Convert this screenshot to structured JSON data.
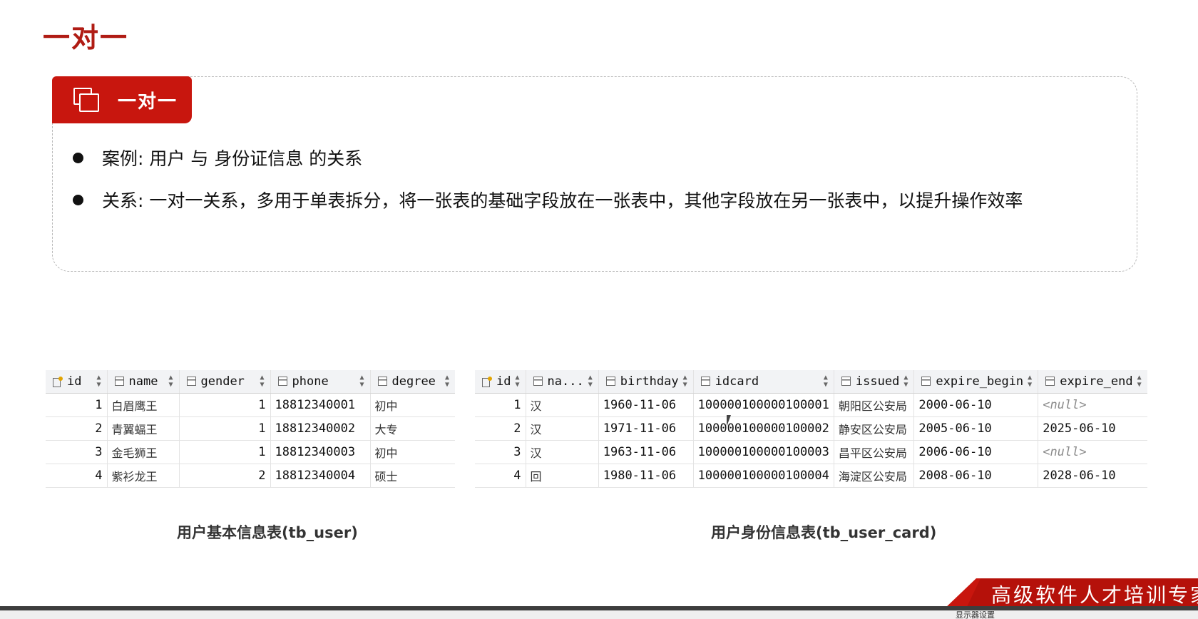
{
  "page": {
    "title": "一对一"
  },
  "card": {
    "tab_label": "一对一",
    "tab_icon": "copy-icon",
    "bullets": [
      "案例: 用户 与 身份证信息 的关系",
      "关系: 一对一关系，多用于单表拆分，将一张表的基础字段放在一张表中，其他字段放在另一张表中，以提升操作效率"
    ]
  },
  "tb_user": {
    "caption": "用户基本信息表(tb_user)",
    "columns": [
      "id",
      "name",
      "gender",
      "phone",
      "degree"
    ],
    "rows": [
      [
        "1",
        "白眉鹰王",
        "1",
        "18812340001",
        "初中"
      ],
      [
        "2",
        "青翼蝠王",
        "1",
        "18812340002",
        "大专"
      ],
      [
        "3",
        "金毛狮王",
        "1",
        "18812340003",
        "初中"
      ],
      [
        "4",
        "紫衫龙王",
        "2",
        "18812340004",
        "硕士"
      ]
    ]
  },
  "tb_user_card": {
    "caption": "用户身份信息表(tb_user_card)",
    "columns": [
      "id",
      "na...",
      "birthday",
      "idcard",
      "issued",
      "expire_begin",
      "expire_end"
    ],
    "rows": [
      [
        "1",
        "汉",
        "1960-11-06",
        "100000100000100001",
        "朝阳区公安局",
        "2000-06-10",
        "<null>"
      ],
      [
        "2",
        "汉",
        "1971-11-06",
        "100000100000100002",
        "静安区公安局",
        "2005-06-10",
        "2025-06-10"
      ],
      [
        "3",
        "汉",
        "1963-11-06",
        "100000100000100003",
        "昌平区公安局",
        "2006-06-10",
        "<null>"
      ],
      [
        "4",
        "回",
        "1980-11-06",
        "100000100000100004",
        "海淀区公安局",
        "2008-06-10",
        "2028-06-10"
      ]
    ]
  },
  "brand": {
    "text": "高级软件人才培训专家"
  },
  "taskbar": {
    "text": "显示器设置"
  },
  "colors": {
    "accent": "#c8160e",
    "title": "#b01c14"
  }
}
